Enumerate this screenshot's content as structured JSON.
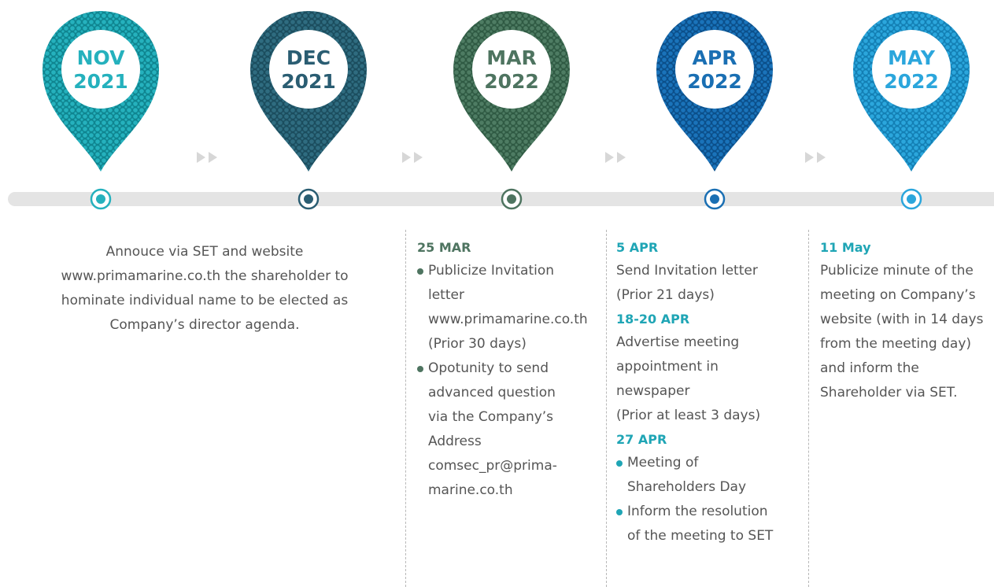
{
  "timeline": {
    "milestones": [
      {
        "month": "NOV",
        "year": "2021",
        "color": "#25b1bd",
        "dark": "#0f8590",
        "text_color": "#25b1bd"
      },
      {
        "month": "DEC",
        "year": "2021",
        "color": "#2f6c80",
        "dark": "#1b4d5e",
        "text_color": "#2a5d72"
      },
      {
        "month": "MAR",
        "year": "2022",
        "color": "#4e7c63",
        "dark": "#2f5a43",
        "text_color": "#4e7460"
      },
      {
        "month": "APR",
        "year": "2022",
        "color": "#1a73ba",
        "dark": "#0b4f8a",
        "text_color": "#1a6fb3"
      },
      {
        "month": "MAY",
        "year": "2022",
        "color": "#2ba6dc",
        "dark": "#137fb4",
        "text_color": "#2ba6dc"
      }
    ]
  },
  "col_nov": {
    "lines": [
      "Annouce via SET and website",
      "www.primamarine.co.th the shareholder to",
      "hominate individual name to be elected as",
      "Company’s director agenda."
    ]
  },
  "col_mar": {
    "date": "25 MAR",
    "date_color": "#4e7460",
    "bullet_color": "#4e7460",
    "bullets": [
      {
        "lines": [
          "Publicize Invitation",
          "letter",
          "www.primamarine.co.th",
          "(Prior 30 days)"
        ]
      },
      {
        "lines": [
          "Opotunity to send",
          "advanced question",
          "via the Company’s",
          "Address",
          "comsec_pr@prima-",
          "marine.co.th"
        ]
      }
    ]
  },
  "col_apr": {
    "date_color": "#1fa5b5",
    "bullet_color": "#1fa5b5",
    "date1": "5 APR",
    "lines1": [
      "Send Invitation letter",
      "(Prior 21 days)"
    ],
    "date2": "18-20 APR",
    "lines2": [
      "Advertise meeting",
      "appointment in",
      "newspaper",
      "(Prior at least 3 days)"
    ],
    "date3": "27 APR",
    "bullets": [
      {
        "lines": [
          "Meeting of",
          "Shareholders Day"
        ]
      },
      {
        "lines": [
          "Inform the resolution",
          "of the meeting to SET"
        ]
      }
    ]
  },
  "col_may": {
    "date": "11 May",
    "date_color": "#1fa5b5",
    "lines": [
      "Publicize minute of the",
      "meeting on Company’s",
      "website (with in 14 days",
      "from the meeting day)",
      "and inform the",
      "Shareholder via SET."
    ]
  }
}
